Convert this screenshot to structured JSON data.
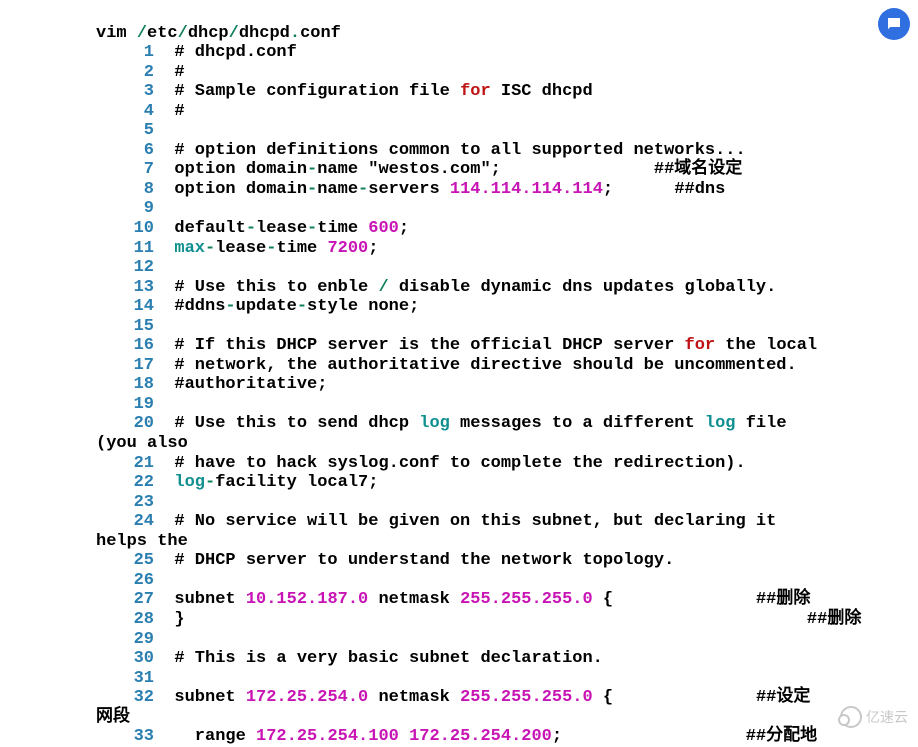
{
  "cmd": {
    "pre": "vim ",
    "s1": "/",
    "p1": "etc",
    "s2": "/",
    "p2": "dhcp",
    "s3": "/",
    "p3": "dhcpd",
    "dot": ".",
    "ext": "conf"
  },
  "lines": {
    "l1": "# dhcpd.conf",
    "l2": "#",
    "l3a": "# Sample configuration file ",
    "l3for": "for",
    "l3b": " ISC dhcpd",
    "l4": "#",
    "l5": "",
    "l6": "# option definitions common to all supported networks...",
    "l7a": "option domain",
    "l7d1": "-",
    "l7b": "name \"westos.com\";",
    "l7pad": "               ",
    "l7c": "##域名设定",
    "l8a": "option domain",
    "l8d1": "-",
    "l8b": "name",
    "l8d2": "-",
    "l8c": "servers ",
    "l8ip": "114.114.114.114",
    "l8semi": ";",
    "l8pad": "      ",
    "l8cmt": "##dns",
    "l9": "",
    "l10a": "default",
    "l10d1": "-",
    "l10b": "lease",
    "l10d2": "-",
    "l10c": "time ",
    "l10n": "600",
    "l10s": ";",
    "l11max": "max",
    "l11d1": "-",
    "l11a": "lease",
    "l11d2": "-",
    "l11b": "time ",
    "l11n": "7200",
    "l11s": ";",
    "l12": "",
    "l13a": "# Use this to enble ",
    "l13s": "/",
    "l13b": " disable dynamic dns updates globally.",
    "l14a": "#ddns",
    "l14d1": "-",
    "l14b": "update",
    "l14d2": "-",
    "l14c": "style none;",
    "l15": "",
    "l16a": "# If this DHCP server is the official DHCP server ",
    "l16for": "for",
    "l16b": " the local",
    "l17": "# network, the authoritative directive should be uncommented.",
    "l18": "#authoritative;",
    "l19": "",
    "l20a": "# Use this to send dhcp ",
    "l20log1": "log",
    "l20b": " messages to a different ",
    "l20log2": "log",
    "l20c": " file",
    "l20wrap": "(you also",
    "l21": "# have to hack syslog.conf to complete the redirection).",
    "l22log": "log",
    "l22d": "-",
    "l22a": "facility local7;",
    "l23": "",
    "l24a": "# No service will be given on this subnet, but declaring it",
    "l24wrap": "helps the",
    "l25": "# DHCP server to understand the network topology.",
    "l26": "",
    "l27a": "subnet ",
    "l27ip1": "10.152.187.0",
    "l27b": " netmask ",
    "l27ip2": "255.255.255.0",
    "l27c": " {",
    "l27pad": "              ",
    "l27cmt": "##删除",
    "l28a": "}",
    "l28pad": "                                                             ",
    "l28cmt": "##删除",
    "l29": "",
    "l30": "# This is a very basic subnet declaration.",
    "l31": "",
    "l32a": "subnet ",
    "l32ip1": "172.25.254.0",
    "l32b": " netmask ",
    "l32ip2": "255.255.255.0",
    "l32c": " {",
    "l32pad": "              ",
    "l32cmt": "##设定",
    "l32wrap": "网段",
    "l33a": "  range ",
    "l33ip1": "172.25.254.100",
    "l33sp": " ",
    "l33ip2": "172.25.254.200",
    "l33s": ";",
    "l33pad": "                  ",
    "l33cmt": "##分配地"
  },
  "nums": {
    "n1": "1",
    "n2": "2",
    "n3": "3",
    "n4": "4",
    "n5": "5",
    "n6": "6",
    "n7": "7",
    "n8": "8",
    "n9": "9",
    "n10": "10",
    "n11": "11",
    "n12": "12",
    "n13": "13",
    "n14": "14",
    "n15": "15",
    "n16": "16",
    "n17": "17",
    "n18": "18",
    "n19": "19",
    "n20": "20",
    "n21": "21",
    "n22": "22",
    "n23": "23",
    "n24": "24",
    "n25": "25",
    "n26": "26",
    "n27": "27",
    "n28": "28",
    "n29": "29",
    "n30": "30",
    "n31": "31",
    "n32": "32",
    "n33": "33"
  },
  "watermark": "亿速云"
}
